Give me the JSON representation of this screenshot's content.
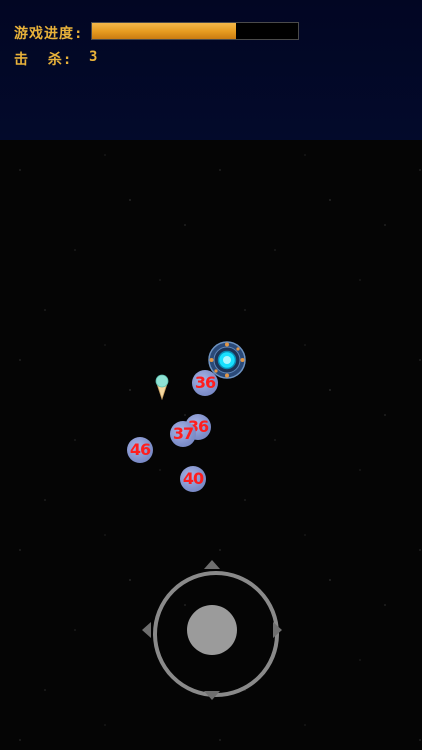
{
  "hud": {
    "progress_label": "游戏进度:",
    "progress_fraction": 0.7,
    "kills_label": "击  杀:",
    "kills_value": "3"
  },
  "enemies": [
    {
      "label": "36"
    },
    {
      "label": "36"
    },
    {
      "label": "37"
    },
    {
      "label": "46"
    },
    {
      "label": "40"
    }
  ],
  "icons": {
    "player": "space-station-icon",
    "pickup": "ice-cream-icon",
    "joystick": "virtual-joystick"
  },
  "colors": {
    "hud_text": "#e8b23a",
    "progress_fill": "#e59a1f",
    "enemy_number": "#ff1e1e",
    "enemy_ball": "#8495cf",
    "player_core": "#18e0ff"
  }
}
